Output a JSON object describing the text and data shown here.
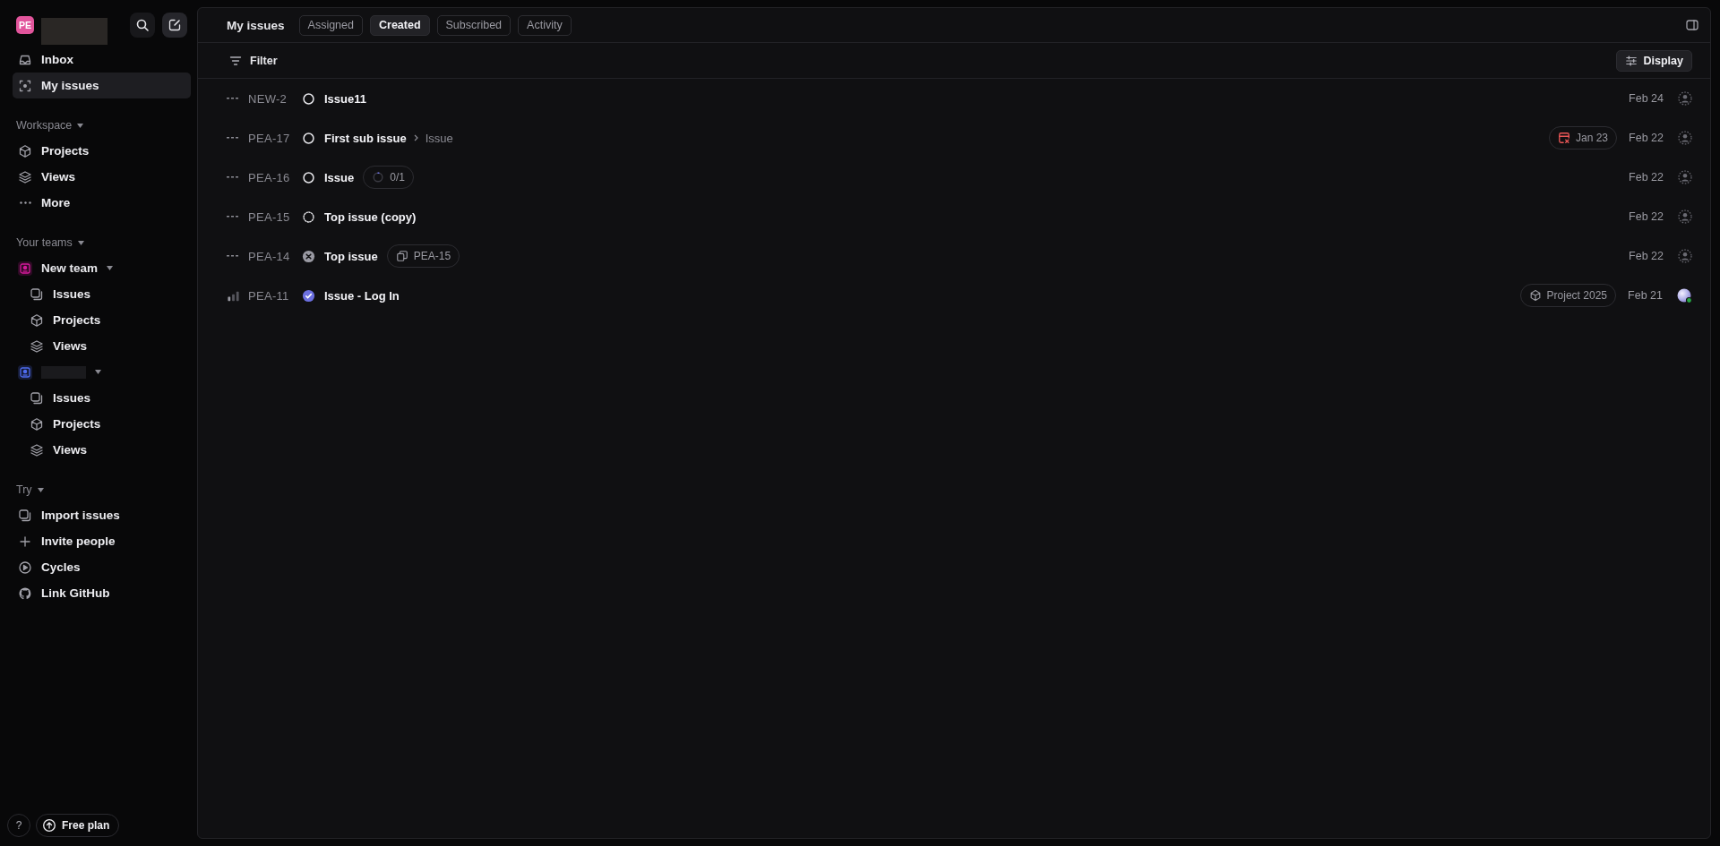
{
  "sidebar": {
    "workspace": {
      "initials": "PE"
    },
    "top_items": [
      {
        "label": "Inbox",
        "kind": "inbox",
        "selected": false
      },
      {
        "label": "My issues",
        "kind": "focus",
        "selected": true
      }
    ],
    "sections": [
      {
        "title": "Workspace",
        "items": [
          {
            "label": "Projects",
            "kind": "cube"
          },
          {
            "label": "Views",
            "kind": "layers"
          },
          {
            "label": "More",
            "kind": "dots"
          }
        ]
      },
      {
        "title": "Your teams",
        "teams": [
          {
            "name": "New team",
            "color": "#d41a9a",
            "children": [
              {
                "label": "Issues",
                "kind": "issues"
              },
              {
                "label": "Projects",
                "kind": "cube"
              },
              {
                "label": "Views",
                "kind": "layers"
              }
            ]
          },
          {
            "color": "#4f6cf0",
            "children": [
              {
                "label": "Issues",
                "kind": "issues"
              },
              {
                "label": "Projects",
                "kind": "cube"
              },
              {
                "label": "Views",
                "kind": "layers"
              }
            ]
          }
        ]
      },
      {
        "title": "Try",
        "items": [
          {
            "label": "Import issues",
            "kind": "issues"
          },
          {
            "label": "Invite people",
            "kind": "plus"
          },
          {
            "label": "Cycles",
            "kind": "cycle"
          },
          {
            "label": "Link GitHub",
            "kind": "github"
          }
        ]
      }
    ],
    "footer": {
      "help": "?",
      "plan": "Free plan"
    }
  },
  "header": {
    "title": "My issues",
    "tabs": [
      {
        "label": "Assigned",
        "selected": false
      },
      {
        "label": "Created",
        "selected": true
      },
      {
        "label": "Subscribed",
        "selected": false
      },
      {
        "label": "Activity",
        "selected": false
      }
    ]
  },
  "toolbar": {
    "filter": "Filter",
    "display": "Display"
  },
  "issues": [
    {
      "priority": {
        "kind": "none"
      },
      "id": "NEW-2",
      "status": {
        "kind": "todo"
      },
      "title": "Issue11",
      "date": "Feb 24",
      "assignee": {
        "kind": "none"
      }
    },
    {
      "priority": {
        "kind": "none"
      },
      "id": "PEA-17",
      "status": {
        "kind": "todo"
      },
      "title": "First sub issue",
      "parent": "Issue",
      "right_badges": [
        {
          "kind": "overdue",
          "label": "Jan 23"
        }
      ],
      "date": "Feb 22",
      "assignee": {
        "kind": "none"
      }
    },
    {
      "priority": {
        "kind": "none"
      },
      "id": "PEA-16",
      "status": {
        "kind": "todo"
      },
      "title": "Issue",
      "badges": [
        {
          "kind": "progress",
          "label": "0/1"
        }
      ],
      "date": "Feb 22",
      "assignee": {
        "kind": "none"
      }
    },
    {
      "priority": {
        "kind": "none"
      },
      "id": "PEA-15",
      "status": {
        "kind": "backlog"
      },
      "title": "Top issue (copy)",
      "date": "Feb 22",
      "assignee": {
        "kind": "none"
      }
    },
    {
      "priority": {
        "kind": "none"
      },
      "id": "PEA-14",
      "status": {
        "kind": "canceled"
      },
      "title": "Top issue",
      "badges": [
        {
          "kind": "duplicate",
          "label": "PEA-15"
        }
      ],
      "date": "Feb 22",
      "assignee": {
        "kind": "none"
      }
    },
    {
      "priority": {
        "kind": "low"
      },
      "id": "PEA-11",
      "status": {
        "kind": "done"
      },
      "title": "Issue - Log In",
      "right_badges": [
        {
          "kind": "project",
          "label": "Project 2025"
        }
      ],
      "date": "Feb 21",
      "assignee": {
        "kind": "user"
      }
    }
  ]
}
